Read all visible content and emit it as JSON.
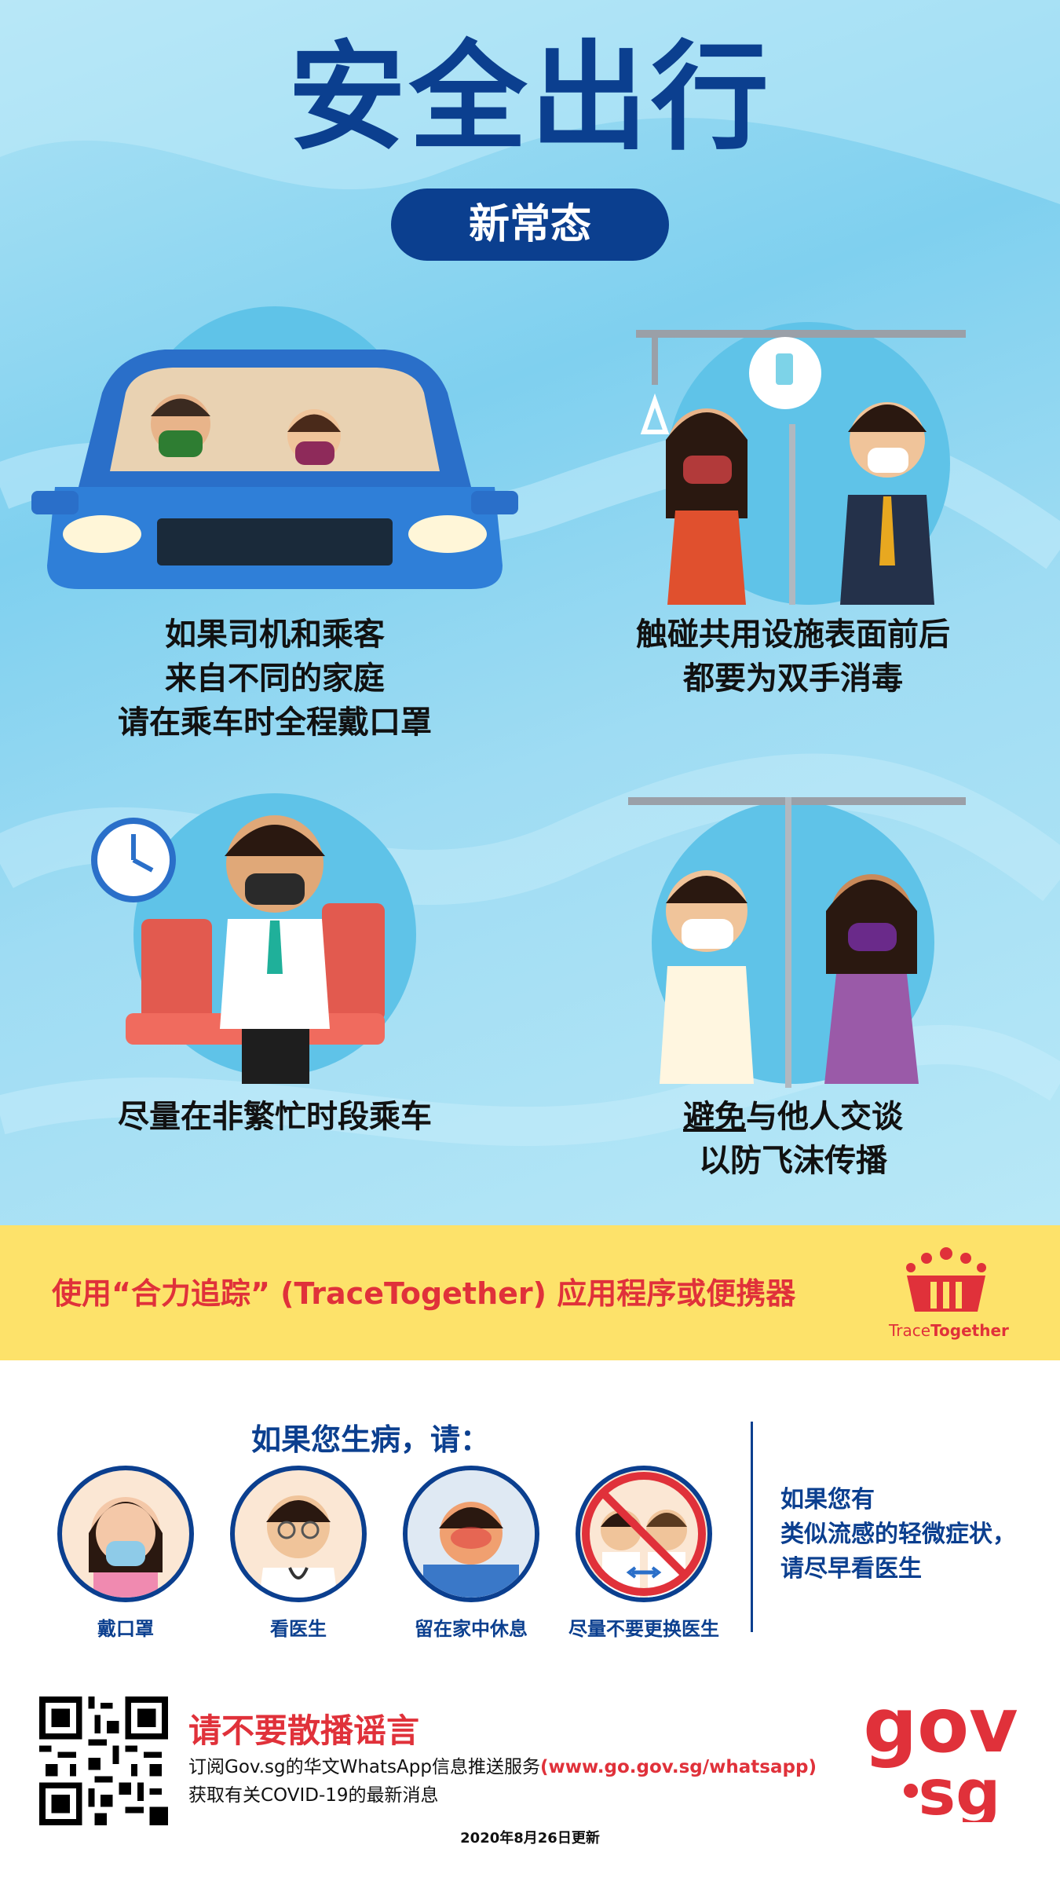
{
  "header": {
    "title": "安全出行",
    "subtitle": "新常态"
  },
  "tips": [
    {
      "lines": [
        "如果司机和乘客",
        "来自不同的家庭",
        "请在乘车时全程戴口罩"
      ]
    },
    {
      "lines": [
        "触碰共用设施表面前后",
        "都要为双手消毒"
      ]
    },
    {
      "lines": [
        "尽量在非繁忙时段乘车"
      ]
    },
    {
      "lines": [
        "避免",
        "与他人交谈",
        "以防飞沫传播"
      ]
    }
  ],
  "banner": {
    "text": "使用“合力追踪” (TraceTogether) 应用程序或便携器",
    "logo_name_a": "Trace",
    "logo_name_b": "Together"
  },
  "sick": {
    "title": "如果您生病，请：",
    "items": [
      {
        "label": "戴口罩",
        "icon": "masked-woman-icon"
      },
      {
        "label": "看医生",
        "icon": "doctor-icon"
      },
      {
        "label": "留在家中休息",
        "icon": "resting-patient-icon"
      },
      {
        "label": "尽量不要更换医生",
        "icon": "no-doctor-switch-icon"
      }
    ],
    "flu_lines": [
      "如果您有",
      "类似流感的轻微症状，",
      "请尽早看医生"
    ]
  },
  "footer": {
    "rumor_title": "请不要散播谣言",
    "line1_a": "订阅Gov.sg的华文WhatsApp信息推送服务",
    "line1_b": "(www.go.gov.sg/whatsapp)",
    "line2": "获取有关COVID-19的最新消息",
    "updated": "2020年8月26日更新",
    "gov_a": "gov",
    "gov_b": "sg"
  },
  "colors": {
    "navy": "#0b3f8f",
    "red": "#e0313a",
    "yellow": "#fde26a",
    "sky": "#8fd6f1"
  }
}
